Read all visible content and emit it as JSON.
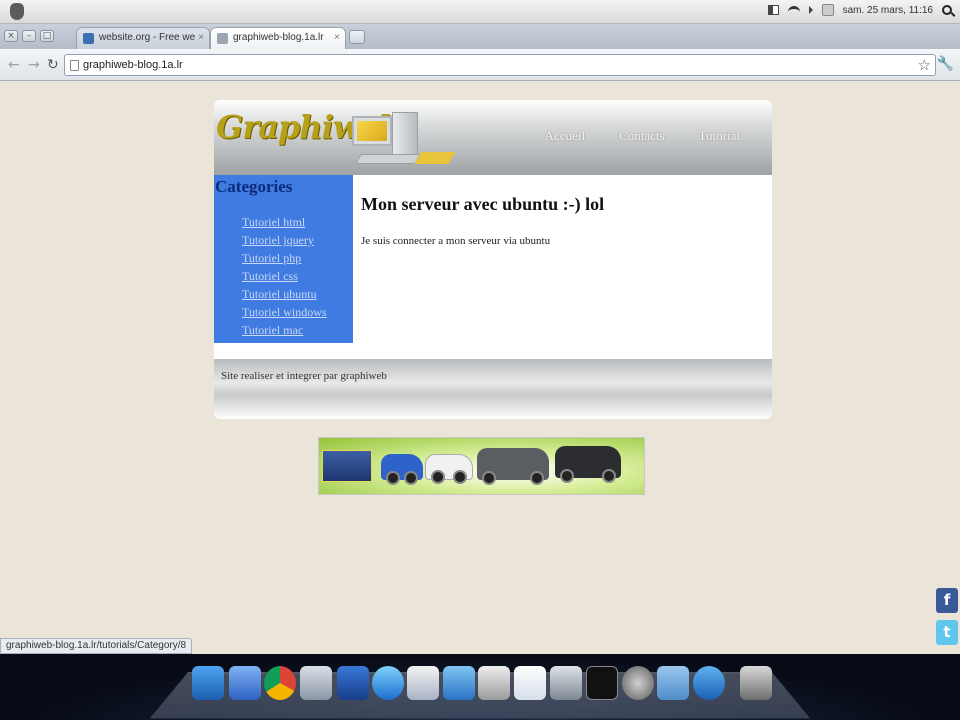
{
  "system_bar": {
    "clock": "sam. 25 mars, 11:16",
    "icons": [
      "apple-menu-icon",
      "battery-icon",
      "wifi-icon",
      "volume-icon",
      "chat-icon",
      "spotlight-search-icon"
    ]
  },
  "browser": {
    "tabs": [
      {
        "label": "website.org - Free we",
        "active": false
      },
      {
        "label": "graphiweb-blog.1a.lr",
        "active": true
      }
    ],
    "url": "graphiweb-blog.1a.lr",
    "status_url": "graphiweb-blog.1a.lr/tutorials/Category/8"
  },
  "site": {
    "logo": "Graphiweb",
    "nav": [
      "Accueil",
      "Contacts",
      "Tutorial"
    ],
    "sidebar_title": "Categories",
    "categories": [
      "Tutoriel html",
      "Tutoriel jquery",
      "Tutoriel php",
      "Tutoriel css",
      "Tutoriel ubuntu",
      "Tutoriel windows",
      "Tutoriel mac"
    ],
    "post_title": "Mon serveur avec ubuntu :-) lol",
    "post_body": "Je suis connecter a mon serveur via ubuntu",
    "footer": "Site realiser et integrer par graphiweb"
  },
  "colors": {
    "sidebar": "#3f7be0",
    "page_bg": "#ebe4d8",
    "logo": "#b8a11a"
  },
  "dock": {
    "icons": [
      "anchor-icon",
      "finder-icon",
      "chrome-icon",
      "preview-icon",
      "butterfly-icon",
      "itunes-icon",
      "photos-icon",
      "mail-icon",
      "drive-icon",
      "textedit-icon",
      "calculator-icon",
      "terminal-icon",
      "settings-icon",
      "folder-icon",
      "messenger-icon",
      "trash-icon"
    ]
  }
}
